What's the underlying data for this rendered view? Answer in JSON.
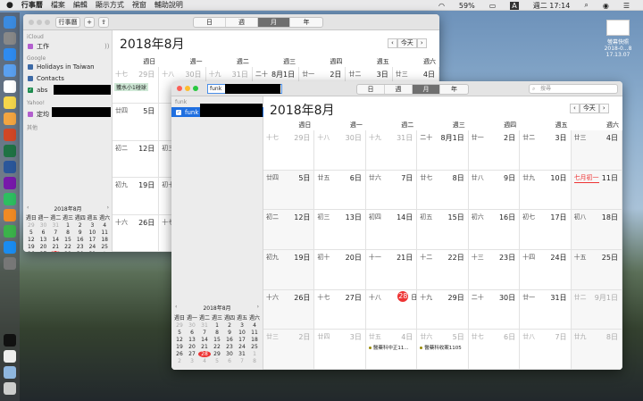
{
  "menubar": {
    "items": [
      "行事曆",
      "檔案",
      "編輯",
      "顯示方式",
      "視窗",
      "輔助說明"
    ],
    "battery": "59%",
    "input_method": "A",
    "clock": "週二 17:14"
  },
  "desktop": {
    "file_label": "螢幕快照 2018-0...8 17.13.07"
  },
  "back_window": {
    "toolbar": {
      "calendars_btn": "行事曆",
      "add_btn": "+",
      "view_tabs": [
        "日",
        "週",
        "月",
        "年"
      ],
      "selected_tab": "月"
    },
    "sidebar": {
      "icloud_label": "iCloud",
      "icloud_items": [
        {
          "name": "工作",
          "color": "#b35fce",
          "checked": false
        }
      ],
      "google_label": "Google",
      "google_items": [
        {
          "name": "Holidays in Taiwan",
          "color": "#3d6aa6",
          "checked": false
        },
        {
          "name": "Contacts",
          "color": "#3d6aa6",
          "checked": false
        },
        {
          "name": "abs",
          "color": "#1d8b4e",
          "checked": true
        }
      ],
      "yahoo_label": "Yahoo!",
      "yahoo_items": [
        {
          "name": "定均",
          "color": "#b35fce",
          "checked": false
        }
      ],
      "other_label": "其他"
    },
    "mini": {
      "title": "2018年8月",
      "prev": "‹",
      "next": "›",
      "weekdays": [
        "週日",
        "週一",
        "週二",
        "週三",
        "週四",
        "週五",
        "週六"
      ],
      "days": [
        [
          "29",
          "o"
        ],
        [
          "30",
          "o"
        ],
        [
          "31",
          "o"
        ],
        [
          "1",
          ""
        ],
        [
          "2",
          ""
        ],
        [
          "3",
          ""
        ],
        [
          "4",
          ""
        ],
        [
          "5",
          ""
        ],
        [
          "6",
          ""
        ],
        [
          "7",
          ""
        ],
        [
          "8",
          ""
        ],
        [
          "9",
          ""
        ],
        [
          "10",
          ""
        ],
        [
          "11",
          ""
        ],
        [
          "12",
          ""
        ],
        [
          "13",
          ""
        ],
        [
          "14",
          ""
        ],
        [
          "15",
          ""
        ],
        [
          "16",
          ""
        ],
        [
          "17",
          ""
        ],
        [
          "18",
          ""
        ],
        [
          "19",
          ""
        ],
        [
          "20",
          ""
        ],
        [
          "21",
          ""
        ],
        [
          "22",
          ""
        ],
        [
          "23",
          ""
        ],
        [
          "24",
          ""
        ],
        [
          "25",
          ""
        ],
        [
          "26",
          ""
        ],
        [
          "27",
          ""
        ],
        [
          "28",
          "t"
        ],
        [
          "29",
          ""
        ],
        [
          "30",
          ""
        ],
        [
          "31",
          ""
        ],
        [
          "1",
          "o"
        ],
        [
          "2",
          "o"
        ],
        [
          "3",
          "o"
        ],
        [
          "4",
          "o"
        ],
        [
          "5",
          "o"
        ],
        [
          "6",
          "o"
        ],
        [
          "7",
          "o"
        ],
        [
          "8",
          "o"
        ]
      ]
    },
    "month_title": "2018年8月",
    "today_btn": "今天",
    "prev": "‹",
    "next": "›",
    "weekdays": [
      "週日",
      "週一",
      "週二",
      "週三",
      "週四",
      "週五",
      "週六"
    ],
    "cells": [
      {
        "l": "十七",
        "d": "29日",
        "o": 1
      },
      {
        "l": "十八",
        "d": "30日",
        "o": 1
      },
      {
        "l": "十九",
        "d": "31日",
        "o": 1
      },
      {
        "l": "二十",
        "d": "8月1日"
      },
      {
        "l": "廿一",
        "d": "2日"
      },
      {
        "l": "廿二",
        "d": "3日"
      },
      {
        "l": "廿三",
        "d": "4日"
      },
      {
        "l": "廿四",
        "d": "5日"
      },
      {
        "l": "",
        "d": ""
      },
      {
        "l": "",
        "d": ""
      },
      {
        "l": "",
        "d": ""
      },
      {
        "l": "",
        "d": ""
      },
      {
        "l": "",
        "d": ""
      },
      {
        "l": "",
        "d": ""
      },
      {
        "l": "初二",
        "d": "12日"
      },
      {
        "l": "初三",
        "d": ""
      },
      {
        "l": "",
        "d": ""
      },
      {
        "l": "",
        "d": ""
      },
      {
        "l": "",
        "d": ""
      },
      {
        "l": "",
        "d": ""
      },
      {
        "l": "",
        "d": ""
      },
      {
        "l": "初九",
        "d": "19日"
      },
      {
        "l": "初十",
        "d": ""
      },
      {
        "l": "",
        "d": ""
      },
      {
        "l": "",
        "d": ""
      },
      {
        "l": "",
        "d": ""
      },
      {
        "l": "",
        "d": ""
      },
      {
        "l": "",
        "d": ""
      },
      {
        "l": "十六",
        "d": "26日"
      },
      {
        "l": "十七",
        "d": ""
      },
      {
        "l": "",
        "d": ""
      },
      {
        "l": "",
        "d": ""
      },
      {
        "l": "",
        "d": ""
      },
      {
        "l": "",
        "d": ""
      },
      {
        "l": "",
        "d": ""
      }
    ],
    "event_week1": "獲水小1碰球"
  },
  "front_window": {
    "title_field": "funk",
    "toolbar": {
      "view_tabs": [
        "日",
        "週",
        "月",
        "年"
      ],
      "selected_tab": "月",
      "search_placeholder": "搜尋"
    },
    "sidebar": {
      "group_label": "funk",
      "items": [
        {
          "name": "funk",
          "checked": true,
          "selected": true
        }
      ]
    },
    "mini": {
      "title": "2018年8月",
      "prev": "‹",
      "next": "›",
      "weekdays": [
        "週日",
        "週一",
        "週二",
        "週三",
        "週四",
        "週五",
        "週六"
      ],
      "days": [
        [
          "29",
          "o"
        ],
        [
          "30",
          "o"
        ],
        [
          "31",
          "o"
        ],
        [
          "1",
          ""
        ],
        [
          "2",
          ""
        ],
        [
          "3",
          ""
        ],
        [
          "4",
          ""
        ],
        [
          "5",
          ""
        ],
        [
          "6",
          ""
        ],
        [
          "7",
          ""
        ],
        [
          "8",
          ""
        ],
        [
          "9",
          ""
        ],
        [
          "10",
          ""
        ],
        [
          "11",
          ""
        ],
        [
          "12",
          ""
        ],
        [
          "13",
          ""
        ],
        [
          "14",
          ""
        ],
        [
          "15",
          ""
        ],
        [
          "16",
          ""
        ],
        [
          "17",
          ""
        ],
        [
          "18",
          ""
        ],
        [
          "19",
          ""
        ],
        [
          "20",
          ""
        ],
        [
          "21",
          ""
        ],
        [
          "22",
          ""
        ],
        [
          "23",
          ""
        ],
        [
          "24",
          ""
        ],
        [
          "25",
          ""
        ],
        [
          "26",
          ""
        ],
        [
          "27",
          ""
        ],
        [
          "28",
          "t"
        ],
        [
          "29",
          ""
        ],
        [
          "30",
          ""
        ],
        [
          "31",
          ""
        ],
        [
          "1",
          "o"
        ],
        [
          "2",
          "o"
        ],
        [
          "3",
          "o"
        ],
        [
          "4",
          "o"
        ],
        [
          "5",
          "o"
        ],
        [
          "6",
          "o"
        ],
        [
          "7",
          "o"
        ],
        [
          "8",
          "o"
        ]
      ]
    },
    "month_title": "2018年8月",
    "today_btn": "今天",
    "prev": "‹",
    "next": "›",
    "weekdays": [
      "週日",
      "週一",
      "週二",
      "週三",
      "週四",
      "週五",
      "週六"
    ],
    "cells": [
      {
        "l": "十七",
        "d": "29日",
        "o": 1
      },
      {
        "l": "十八",
        "d": "30日",
        "o": 1
      },
      {
        "l": "十九",
        "d": "31日",
        "o": 1
      },
      {
        "l": "二十",
        "d": "8月1日"
      },
      {
        "l": "廿一",
        "d": "2日"
      },
      {
        "l": "廿二",
        "d": "3日"
      },
      {
        "l": "廿三",
        "d": "4日",
        "w": 1
      },
      {
        "l": "廿四",
        "d": "5日",
        "w": 1
      },
      {
        "l": "廿五",
        "d": "6日"
      },
      {
        "l": "廿六",
        "d": "7日"
      },
      {
        "l": "廿七",
        "d": "8日"
      },
      {
        "l": "廿八",
        "d": "9日"
      },
      {
        "l": "廿九",
        "d": "10日"
      },
      {
        "l": "七月初一",
        "d": "11日",
        "w": 1,
        "red": 1
      },
      {
        "l": "初二",
        "d": "12日",
        "w": 1
      },
      {
        "l": "初三",
        "d": "13日"
      },
      {
        "l": "初四",
        "d": "14日"
      },
      {
        "l": "初五",
        "d": "15日"
      },
      {
        "l": "初六",
        "d": "16日"
      },
      {
        "l": "初七",
        "d": "17日"
      },
      {
        "l": "初八",
        "d": "18日",
        "w": 1
      },
      {
        "l": "初九",
        "d": "19日",
        "w": 1
      },
      {
        "l": "初十",
        "d": "20日"
      },
      {
        "l": "十一",
        "d": "21日"
      },
      {
        "l": "十二",
        "d": "22日"
      },
      {
        "l": "十三",
        "d": "23日"
      },
      {
        "l": "十四",
        "d": "24日"
      },
      {
        "l": "十五",
        "d": "25日",
        "w": 1
      },
      {
        "l": "十六",
        "d": "26日",
        "w": 1
      },
      {
        "l": "十七",
        "d": "27日"
      },
      {
        "l": "十八",
        "d": "28日",
        "today": 1
      },
      {
        "l": "十九",
        "d": "29日"
      },
      {
        "l": "二十",
        "d": "30日"
      },
      {
        "l": "廿一",
        "d": "31日"
      },
      {
        "l": "廿二",
        "d": "9月1日",
        "o": 1,
        "w": 1
      },
      {
        "l": "廿三",
        "d": "2日",
        "o": 1,
        "w": 1
      },
      {
        "l": "廿四",
        "d": "3日",
        "o": 1
      },
      {
        "l": "廿五",
        "d": "4日",
        "o": 1,
        "ev": "醫藥科中正11..."
      },
      {
        "l": "廿六",
        "d": "5日",
        "o": 1,
        "ev": "醫藥科收案1105"
      },
      {
        "l": "廿七",
        "d": "6日",
        "o": 1
      },
      {
        "l": "廿八",
        "d": "7日",
        "o": 1
      },
      {
        "l": "廿九",
        "d": "8日",
        "o": 1,
        "w": 1
      }
    ]
  },
  "colors": {
    "accent": "#1a73e8",
    "today": "#e33333",
    "selection": "#1f6fe0"
  }
}
